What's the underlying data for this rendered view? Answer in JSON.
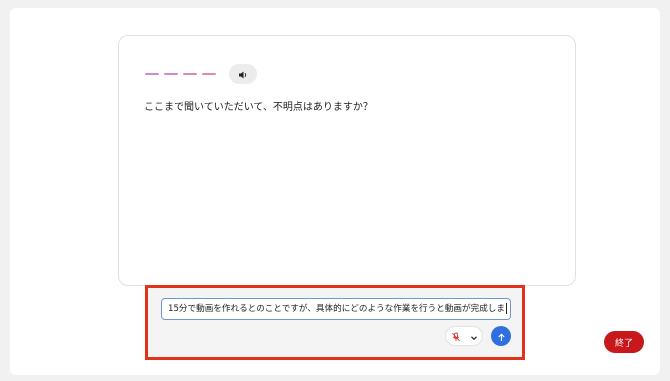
{
  "conversation": {
    "question": "ここまで聞いていただいて、不明点はありますか？",
    "dash_colors": [
      "#c68ad6",
      "#d685c8",
      "#e083b8",
      "#e08ab0"
    ]
  },
  "input": {
    "value": "15分で動画を作れるとのことですが、具体的にどのような作業を行うと動画が完成しま"
  },
  "icons": {
    "speaker": "speaker-icon",
    "mic_muted": "mic-muted-icon",
    "chevron": "chevron-down-icon",
    "send": "arrow-up-icon"
  },
  "colors": {
    "highlight": "#e1331a",
    "send": "#2f6fe0",
    "end": "#c8181c",
    "mic_muted": "#d9383a"
  },
  "end_button": {
    "label": "終了"
  }
}
